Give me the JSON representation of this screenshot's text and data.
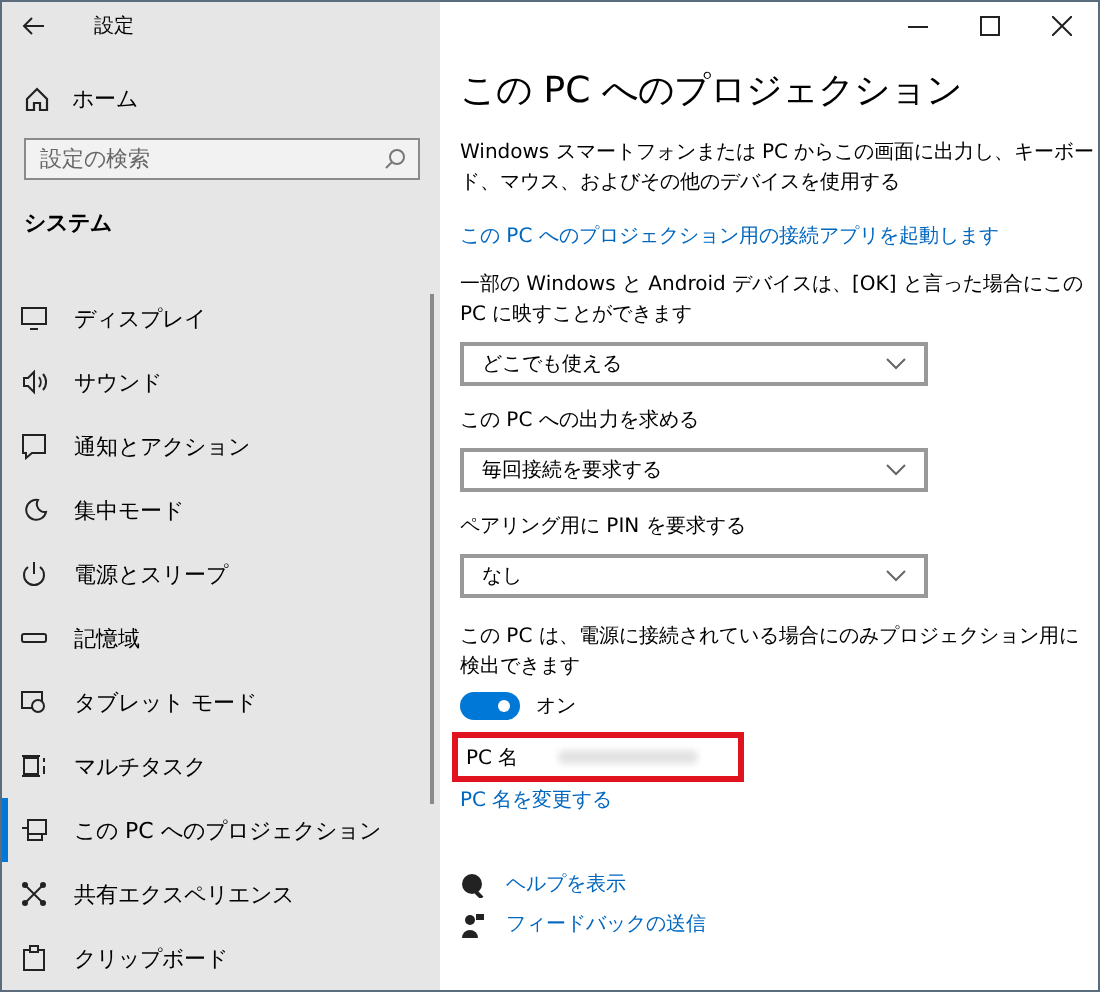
{
  "window": {
    "title": "設定"
  },
  "sidebar": {
    "home": "ホーム",
    "search": {
      "placeholder": "設定の検索"
    },
    "section": "システム",
    "items": [
      {
        "label": "ディスプレイ",
        "selected": false
      },
      {
        "label": "サウンド",
        "selected": false
      },
      {
        "label": "通知とアクション",
        "selected": false
      },
      {
        "label": "集中モード",
        "selected": false
      },
      {
        "label": "電源とスリープ",
        "selected": false
      },
      {
        "label": "記憶域",
        "selected": false
      },
      {
        "label": "タブレット モード",
        "selected": false
      },
      {
        "label": "マルチタスク",
        "selected": false
      },
      {
        "label": "この PC へのプロジェクション",
        "selected": true
      },
      {
        "label": "共有エクスペリエンス",
        "selected": false
      },
      {
        "label": "クリップボード",
        "selected": false
      }
    ]
  },
  "content": {
    "heading": "この PC へのプロジェクション",
    "description": "Windows スマートフォンまたは PC からこの画面に出力し、キーボード、マウス、およびその他のデバイスを使用する",
    "connect_link": "この PC へのプロジェクション用の接続アプリを起動します",
    "settings": [
      {
        "label": "一部の Windows と Android デバイスは、[OK] と言った場合にこの PC に映すことができます",
        "value": "どこでも使える"
      },
      {
        "label": "この PC への出力を求める",
        "value": "毎回接続を要求する"
      },
      {
        "label": "ペアリング用に PIN を要求する",
        "value": "なし"
      }
    ],
    "power_label": "この PC は、電源に接続されている場合にのみプロジェクション用に検出できます",
    "power_toggle": {
      "on": true,
      "label": "オン"
    },
    "pc_name_label": "PC 名",
    "rename_link": "PC 名を変更する",
    "help_links": [
      "ヘルプを表示",
      "フィードバックの送信"
    ]
  }
}
